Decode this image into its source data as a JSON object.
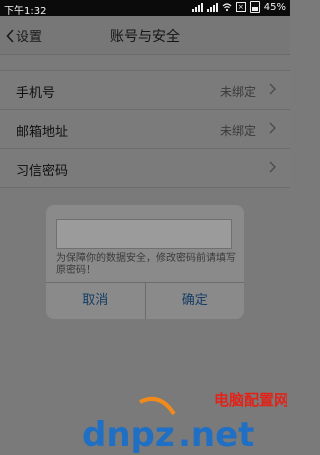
{
  "status_bar": {
    "time": "下午1:32",
    "battery": "45%",
    "icons": [
      "signal-icon",
      "signal-icon",
      "wifi-icon",
      "close-box-icon",
      "battery-icon"
    ]
  },
  "nav": {
    "back_label": "设置",
    "title": "账号与安全"
  },
  "rows": [
    {
      "label": "手机号",
      "value": "未绑定"
    },
    {
      "label": "邮箱地址",
      "value": "未绑定"
    },
    {
      "label": "习信密码",
      "value": ""
    }
  ],
  "dialog": {
    "input_value": "",
    "hint": "为保障你的数据安全，修改密码前请填写原密码！",
    "cancel": "取消",
    "confirm": "确定"
  },
  "watermark": {
    "brand": "电脑配置网",
    "domain": "dnpz.net"
  },
  "colors": {
    "dialog_button_text": "#153d66",
    "overlay_background": "#7a7a7a"
  }
}
